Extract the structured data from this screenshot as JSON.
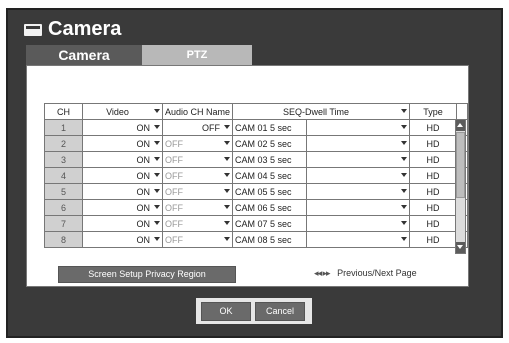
{
  "window": {
    "title": "Camera",
    "icon": "camera-icon"
  },
  "tabs": [
    {
      "label": "Camera",
      "active": true
    },
    {
      "label": "PTZ",
      "active": false
    }
  ],
  "table": {
    "headers": {
      "ch": "CH",
      "video": "Video",
      "audio": "Audio",
      "ch_name": "CH Name",
      "seq": "SEQ-Dwell Time",
      "type": "Type"
    },
    "rows": [
      {
        "ch": "1",
        "video": "ON",
        "audio": "OFF",
        "name": "CAM 01",
        "dwell": "5 sec",
        "type": "HD"
      },
      {
        "ch": "2",
        "video": "ON",
        "audio": "OFF",
        "name": "CAM 02",
        "dwell": "5 sec",
        "type": "HD"
      },
      {
        "ch": "3",
        "video": "ON",
        "audio": "OFF",
        "name": "CAM 03",
        "dwell": "5 sec",
        "type": "HD"
      },
      {
        "ch": "4",
        "video": "ON",
        "audio": "OFF",
        "name": "CAM 04",
        "dwell": "5 sec",
        "type": "HD"
      },
      {
        "ch": "5",
        "video": "ON",
        "audio": "OFF",
        "name": "CAM 05",
        "dwell": "5 sec",
        "type": "HD"
      },
      {
        "ch": "6",
        "video": "ON",
        "audio": "OFF",
        "name": "CAM 06",
        "dwell": "5 sec",
        "type": "HD"
      },
      {
        "ch": "7",
        "video": "ON",
        "audio": "OFF",
        "name": "CAM 07",
        "dwell": "5 sec",
        "type": "HD"
      },
      {
        "ch": "8",
        "video": "ON",
        "audio": "OFF",
        "name": "CAM 08",
        "dwell": "5 sec",
        "type": "HD"
      }
    ]
  },
  "buttons": {
    "privacy": "Screen Setup Privacy Region",
    "pager_arrows": "◂◂ ▸▸",
    "pager": "Previous/Next Page",
    "ok": "OK",
    "cancel": "Cancel"
  },
  "colors": {
    "window_bg": "#3a3a3a",
    "active_tab": "#5a5a5a",
    "inactive_tab": "#b8b8b8",
    "button": "#6a6a6a"
  }
}
